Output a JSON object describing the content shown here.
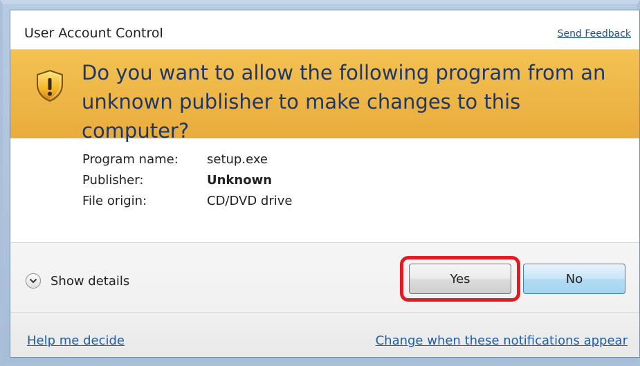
{
  "titlebar": {
    "title": "User Account Control",
    "send_feedback": "Send Feedback"
  },
  "banner": {
    "icon": "shield-warning-icon",
    "message": "Do you want to allow the following program from an unknown publisher to make changes to this computer?"
  },
  "info": {
    "rows": [
      {
        "label": "Program name:",
        "value": "setup.exe"
      },
      {
        "label": "Publisher:",
        "value": "Unknown"
      },
      {
        "label": "File origin:",
        "value": "CD/DVD drive"
      }
    ]
  },
  "footer": {
    "show_details": "Show details",
    "yes_label": "Yes",
    "no_label": "No"
  },
  "links": {
    "help": "Help me decide",
    "change": "Change when these notifications appear"
  },
  "colors": {
    "banner": "#efb849",
    "link": "#1f5fa8",
    "highlight": "#e01b22"
  }
}
